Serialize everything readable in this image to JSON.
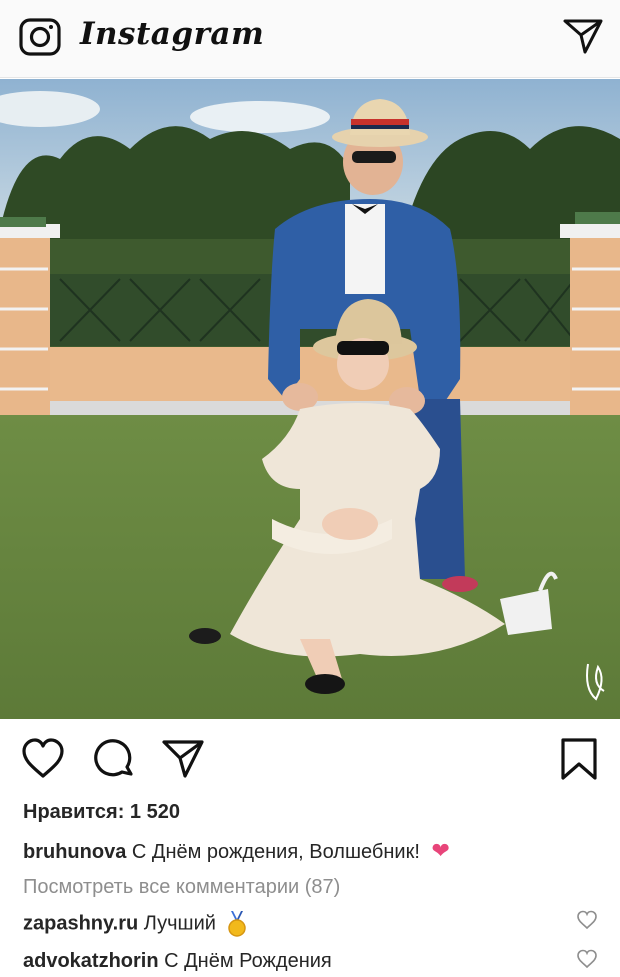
{
  "app": {
    "title": "Instagram",
    "icons": [
      "camera-icon",
      "direct-message-icon"
    ]
  },
  "post": {
    "likes_text": "Нравится: 1 520",
    "caption": {
      "username": "bruhunova",
      "text": "С Днём рождения, Волшебник!",
      "emoji": "❤"
    },
    "view_all_comments": "Посмотреть все комментарии (87)",
    "comments": [
      {
        "username": "zapashny.ru",
        "text": "Лучший",
        "emoji": "medal-icon"
      },
      {
        "username": "advokatzhorin",
        "text": "С Днём Рождения"
      }
    ],
    "action_icons": [
      "like-icon",
      "comment-icon",
      "share-icon",
      "save-icon"
    ]
  },
  "colors": {
    "emoji_heart": "#e8457a",
    "muted_text": "#8e8e8e",
    "text": "#262626"
  }
}
